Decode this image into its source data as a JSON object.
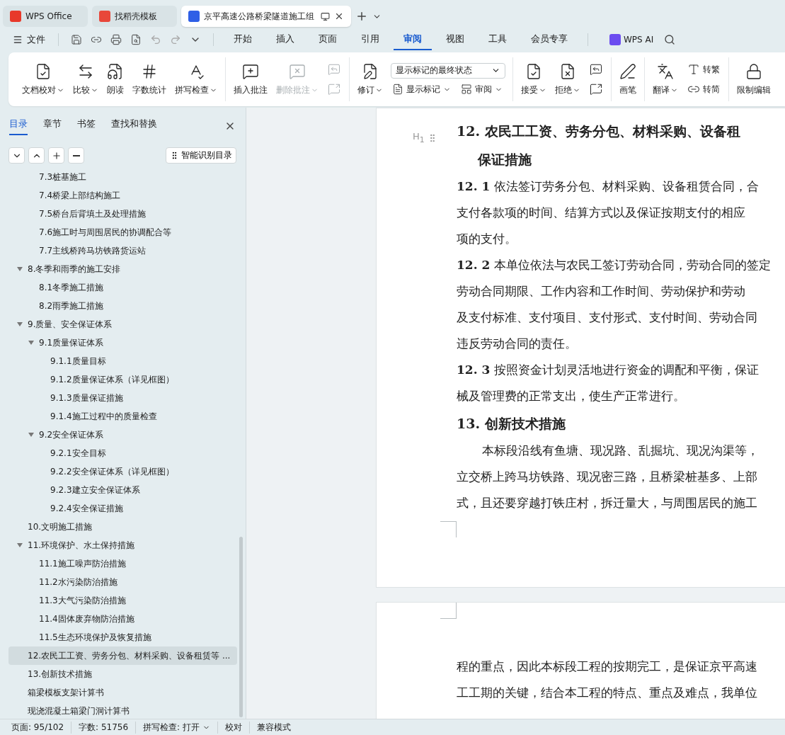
{
  "browser_tabs": [
    {
      "label": "WPS Office",
      "selected": false
    },
    {
      "label": "找稻壳模板",
      "selected": false
    },
    {
      "label": "京平高速公路桥梁隧道施工组",
      "selected": true
    }
  ],
  "menu": {
    "file": "文件",
    "tabs": [
      {
        "label": "开始",
        "selected": false
      },
      {
        "label": "插入",
        "selected": false
      },
      {
        "label": "页面",
        "selected": false
      },
      {
        "label": "引用",
        "selected": false
      },
      {
        "label": "审阅",
        "selected": true
      },
      {
        "label": "视图",
        "selected": false
      },
      {
        "label": "工具",
        "selected": false
      },
      {
        "label": "会员专享",
        "selected": false
      }
    ],
    "ai": "WPS AI"
  },
  "ribbon": [
    {
      "items": [
        {
          "kind": "large",
          "label": "文档校对",
          "dropdown": true,
          "disabled": false
        },
        {
          "kind": "large",
          "label": "比较",
          "dropdown": true,
          "disabled": false
        },
        {
          "kind": "large",
          "label": "朗读",
          "dropdown": false,
          "disabled": false
        },
        {
          "kind": "large",
          "label": "字数统计",
          "dropdown": false,
          "disabled": false
        },
        {
          "kind": "large",
          "label": "拼写检查",
          "dropdown": true,
          "disabled": false
        }
      ]
    },
    {
      "items": [
        {
          "kind": "large",
          "label": "插入批注",
          "dropdown": false,
          "disabled": false
        },
        {
          "kind": "large",
          "label": "删除批注",
          "dropdown": true,
          "disabled": true
        },
        {
          "kind": "small",
          "dropdown": false,
          "disabled": true
        },
        {
          "kind": "small",
          "dropdown": false,
          "disabled": true
        }
      ]
    },
    {
      "items": [
        {
          "kind": "large",
          "label": "修订",
          "dropdown": true,
          "disabled": false
        },
        {
          "kind": "select",
          "value": "显示标记的最终状态",
          "buttons": [
            {
              "label": "显示标记",
              "dropdown": true
            },
            {
              "label": "审阅",
              "dropdown": true
            }
          ]
        }
      ]
    },
    {
      "items": [
        {
          "kind": "large",
          "label": "接受",
          "dropdown": true,
          "disabled": false
        },
        {
          "kind": "large",
          "label": "拒绝",
          "dropdown": true,
          "disabled": false
        },
        {
          "kind": "small",
          "dropdown": false,
          "disabled": false
        },
        {
          "kind": "small",
          "dropdown": false,
          "disabled": false
        }
      ]
    },
    {
      "items": [
        {
          "kind": "large",
          "label": "画笔",
          "dropdown": false,
          "disabled": false
        }
      ]
    },
    {
      "items": [
        {
          "kind": "large",
          "label": "翻译",
          "dropdown": true,
          "disabled": false
        },
        {
          "kind": "small",
          "label": "转繁",
          "dropdown": false,
          "disabled": false
        },
        {
          "kind": "small",
          "label": "转简",
          "dropdown": false,
          "disabled": false
        }
      ]
    },
    {
      "items": [
        {
          "kind": "large",
          "label": "限制编辑",
          "dropdown": false,
          "disabled": false
        }
      ]
    }
  ],
  "sidebar": {
    "tabs": [
      {
        "label": "目录",
        "selected": true
      },
      {
        "label": "章节",
        "selected": false
      },
      {
        "label": "书签",
        "selected": false
      },
      {
        "label": "查找和替换",
        "selected": false
      }
    ],
    "smart_button": "智能识别目录",
    "outline": [
      {
        "children": [
          {
            "label": "7.3桩基施工",
            "selected": false
          },
          {
            "label": "7.4桥梁上部结构施工",
            "selected": false
          },
          {
            "label": "7.5桥台后背填土及处理措施",
            "selected": false
          },
          {
            "label": "7.6施工时与周围居民的协调配合等",
            "selected": false
          },
          {
            "label": "7.7主线桥跨马坊铁路货运站",
            "selected": false
          }
        ]
      },
      {
        "label": "8.冬季和雨季的施工安排",
        "selected": false,
        "expanded": true,
        "children": [
          {
            "label": "8.1冬季施工措施",
            "selected": false
          },
          {
            "label": "8.2雨季施工措施",
            "selected": false
          }
        ]
      },
      {
        "label": "9.质量、安全保证体系",
        "selected": false,
        "expanded": true,
        "children": [
          {
            "label": "9.1质量保证体系",
            "selected": false,
            "expanded": true,
            "children": [
              {
                "label": "9.1.1质量目标",
                "selected": false
              },
              {
                "label": "9.1.2质量保证体系（详见框图）",
                "selected": false
              },
              {
                "label": "9.1.3质量保证措施",
                "selected": false
              },
              {
                "label": "9.1.4施工过程中的质量检查",
                "selected": false
              }
            ]
          },
          {
            "label": "9.2安全保证体系",
            "selected": false,
            "expanded": true,
            "children": [
              {
                "label": "9.2.1安全目标",
                "selected": false
              },
              {
                "label": "9.2.2安全保证体系（详见框图）",
                "selected": false
              },
              {
                "label": "9.2.3建立安全保证体系",
                "selected": false
              },
              {
                "label": "9.2.4安全保证措施",
                "selected": false
              }
            ]
          }
        ]
      },
      {
        "label": "10.文明施工措施",
        "selected": false
      },
      {
        "label": "11.环境保护、水土保持措施",
        "selected": false,
        "expanded": true,
        "children": [
          {
            "label": "11.1施工噪声防治措施",
            "selected": false
          },
          {
            "label": "11.2水污染防治措施",
            "selected": false
          },
          {
            "label": "11.3大气污染防治措施",
            "selected": false
          },
          {
            "label": "11.4固体废弃物防治措施",
            "selected": false
          },
          {
            "label": "11.5生态环境保护及恢复措施",
            "selected": false
          }
        ]
      },
      {
        "label": "12.农民工工资、劳务分包、材料采购、设备租赁等 ...",
        "selected": true
      },
      {
        "label": "13.创新技术措施",
        "selected": false
      },
      {
        "label": "箱梁模板支架计算书",
        "selected": false
      },
      {
        "label": "现浇混凝土箱梁门洞计算书",
        "selected": false
      }
    ]
  },
  "document": {
    "pages": [
      {
        "blocks": [
          {
            "kind": "heading",
            "marker": "H$_{1}$",
            "lines": [
              "12.  农民工工资、劳务分包、材料采购、设备租",
              "保证措施"
            ]
          },
          {
            "kind": "paragraph",
            "lines": [
              "**12. 1** 依法签订劳务分包、材料采购、设备租赁合同，合",
              "支付各款项的时间、结算方式以及保证按期支付的相应",
              "项的支付。"
            ]
          },
          {
            "kind": "paragraph",
            "lines": [
              "**12. 2** 本单位依法与农民工签订劳动合同，劳动合同的签定",
              "劳动合同期限、工作内容和工作时间、劳动保护和劳动",
              "及支付标准、支付项目、支付形式、支付时间、劳动合同",
              "违反劳动合同的责任。"
            ]
          },
          {
            "kind": "paragraph",
            "lines": [
              "**12. 3** 按照资金计划灵活地进行资金的调配和平衡，保证",
              "械及管理费的正常支出，使生产正常进行。"
            ]
          },
          {
            "kind": "heading",
            "lines": [
              "13.  创新技术措施"
            ]
          },
          {
            "kind": "paragraph",
            "indent": true,
            "lines": [
              "本标段沿线有鱼塘、现况路、乱掘坑、现况沟渠等，",
              "立交桥上跨马坊铁路、现况密三路，且桥梁桩基多、上部",
              "式，且还要穿越打铁庄村，拆迁量大，与周围居民的施工"
            ]
          }
        ]
      },
      {
        "blocks": [
          {
            "kind": "paragraph",
            "lines": [
              "程的重点，因此本标段工程的按期完工，是保证京平高速",
              "工工期的关键，结合本工程的特点、重点及难点，我单位"
            ]
          }
        ]
      }
    ]
  },
  "status_bar": [
    {
      "label": "页面: 95/102",
      "dropdown": false
    },
    {
      "label": "字数: 51756",
      "dropdown": false
    },
    {
      "label": "拼写检查: 打开",
      "dropdown": true
    },
    {
      "label": "校对",
      "dropdown": false
    },
    {
      "label": "兼容模式",
      "dropdown": false
    }
  ]
}
